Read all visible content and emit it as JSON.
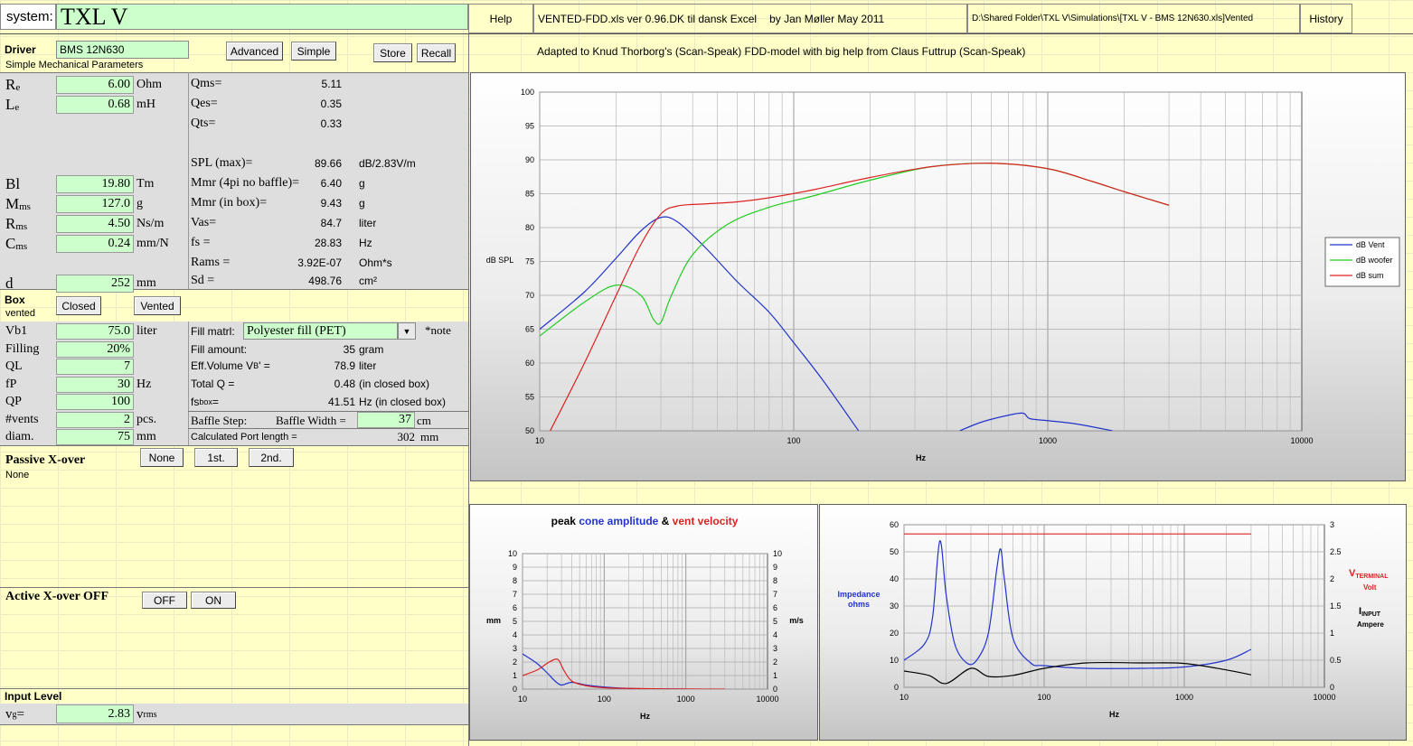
{
  "header": {
    "system_label": "system:",
    "system_name": "TXL V",
    "help": "Help",
    "version": "VENTED-FDD.xls  ver 0.96.DK  til dansk Excel",
    "author": "by  Jan Møller  May 2011",
    "path": "D:\\Shared Folder\\TXL V\\Simulations\\[TXL V - BMS 12N630.xls]Vented",
    "history": "History",
    "adapted": "Adapted to Knud Thorborg's (Scan-Speak)  FDD-model with big help from Claus Futtrup (Scan-Speak)"
  },
  "driver": {
    "label": "Driver",
    "name": "BMS 12N630",
    "sub": "Simple Mechanical Parameters",
    "advanced": "Advanced",
    "simple": "Simple",
    "store": "Store",
    "recall": "Recall"
  },
  "params": [
    {
      "sym": "Re",
      "sub": "e",
      "main": "R",
      "val": "6.00",
      "unit": "Ohm"
    },
    {
      "sym": "Le",
      "sub": "e",
      "main": "L",
      "val": "0.68",
      "unit": "mH"
    },
    {
      "sym": "Bl",
      "main": "Bl",
      "sub": "",
      "val": "19.80",
      "unit": "Tm"
    },
    {
      "sym": "Mms",
      "main": "M",
      "sub": "ms",
      "val": "127.0",
      "unit": "g"
    },
    {
      "sym": "Rms",
      "main": "R",
      "sub": "ms",
      "val": "4.50",
      "unit": "Ns/m"
    },
    {
      "sym": "Cms",
      "main": "C",
      "sub": "ms",
      "val": "0.24",
      "unit": "mm/N"
    },
    {
      "sym": "d",
      "main": "d",
      "sub": "",
      "val": "252",
      "unit": "mm"
    }
  ],
  "derived": [
    {
      "label": "Qms=",
      "val": "5.11",
      "unit": ""
    },
    {
      "label": "Qes=",
      "val": "0.35",
      "unit": ""
    },
    {
      "label": "Qts=",
      "val": "0.33",
      "unit": ""
    },
    {
      "label": "SPL (max)=",
      "val": "89.66",
      "unit": "dB/2.83V/m"
    },
    {
      "label": "Mmr (4pi no baffle)=",
      "val": "6.40",
      "unit": "g"
    },
    {
      "label": "Mmr (in box)=",
      "val": "9.43",
      "unit": "g"
    },
    {
      "label": "Vas=",
      "val": "84.7",
      "unit": "liter"
    },
    {
      "label": "fs =",
      "val": "28.83",
      "unit": "Hz"
    },
    {
      "label": "Rams =",
      "val": "3.92E-07",
      "unit": "Ohm*s"
    },
    {
      "label": "Sd =",
      "val": "498.76",
      "unit": "cm²"
    }
  ],
  "box": {
    "label": "Box",
    "sub": "vented",
    "closed": "Closed",
    "vented": "Vented",
    "rows": [
      {
        "label": "Vb1",
        "val": "75.0",
        "unit": "liter"
      },
      {
        "label": "Filling",
        "val": "20%",
        "unit": ""
      },
      {
        "label": "QL",
        "val": "7",
        "unit": ""
      },
      {
        "label": "fP",
        "val": "30",
        "unit": "Hz"
      },
      {
        "label": "QP",
        "val": "100",
        "unit": ""
      },
      {
        "label": "#vents",
        "val": "2",
        "unit": "pcs."
      },
      {
        "label": "diam.",
        "val": "75",
        "unit": "mm"
      }
    ],
    "fill_label": "Fill matrl:",
    "fill_value": "Polyester fill (PET)",
    "note": "*note",
    "right": [
      {
        "label": "Fill amount:",
        "val": "35",
        "unit": "gram"
      },
      {
        "label": "Eff.Volume V",
        "sub": "B",
        "label2": "' =",
        "val": "78.9",
        "unit": "liter"
      },
      {
        "label": "Total Q =",
        "val": "0.48",
        "unit": "(in closed box)"
      },
      {
        "label": "fs",
        "sub": "box",
        "label2": "=",
        "val": "41.51",
        "unit": "Hz  (in closed box)"
      }
    ],
    "baffle_step": "Baffle Step:",
    "baffle_width": "Baffle Width  =",
    "baffle_val": "37",
    "baffle_unit": "cm",
    "port_label": "Calculated Port length =",
    "port_val": "302",
    "port_unit": "mm"
  },
  "passive": {
    "label": "Passive X-over",
    "state": "None",
    "none": "None",
    "first": "1st.",
    "second": "2nd."
  },
  "active": {
    "label": "Active X-over OFF",
    "off": "OFF",
    "on": "ON"
  },
  "input": {
    "label": "Input Level",
    "sym": "v",
    "sub": "g",
    "eq": " =",
    "val": "2.83",
    "unit": "v",
    "unit_sub": "rms"
  },
  "colors": {
    "vent": "#2233cc",
    "woofer": "#22cc22",
    "sum": "#dd2222"
  },
  "chart_data": [
    {
      "type": "line",
      "title": "",
      "xlabel": "Hz",
      "ylabel": "dB SPL",
      "xscale": "log",
      "xlim": [
        10,
        10000
      ],
      "ylim": [
        50,
        100
      ],
      "xticks": [
        "10",
        "100",
        "1000",
        "10000"
      ],
      "yticks": [
        "50",
        "55",
        "60",
        "65",
        "70",
        "75",
        "80",
        "85",
        "90",
        "95",
        "100"
      ],
      "legend": "right",
      "series": [
        {
          "name": "dB Vent",
          "x": [
            10,
            15,
            20,
            25,
            30,
            35,
            45,
            60,
            80,
            100,
            130,
            180
          ],
          "y": [
            65,
            70.5,
            75.5,
            79.5,
            81.5,
            80.8,
            77,
            72,
            67.5,
            63,
            57.5,
            50
          ]
        },
        {
          "name": "dB Vent",
          "x": [
            450,
            550,
            700,
            800,
            850,
            1000,
            1300,
            1800
          ],
          "y": [
            50,
            51.3,
            52.3,
            52.6,
            51.8,
            51.5,
            51,
            50
          ]
        },
        {
          "name": "dB woofer",
          "x": [
            10,
            15,
            20,
            25,
            28,
            30,
            33,
            40,
            55,
            80,
            120,
            200,
            350,
            600,
            1000,
            1500,
            2000,
            3000
          ],
          "y": [
            64,
            69,
            71.5,
            70,
            66.5,
            66,
            70,
            76,
            80.5,
            83,
            84.7,
            87,
            89,
            89.5,
            88.7,
            86.8,
            85.3,
            83.3
          ]
        },
        {
          "name": "dB sum",
          "x": [
            11,
            15,
            20,
            25,
            30,
            35,
            45,
            60,
            80,
            120,
            200,
            350,
            600,
            1000,
            1500,
            2000,
            3000
          ],
          "y": [
            50,
            60,
            70,
            77.5,
            82,
            83.2,
            83.5,
            83.8,
            84.4,
            85.6,
            87.4,
            89,
            89.5,
            88.7,
            86.8,
            85.3,
            83.3
          ]
        }
      ]
    },
    {
      "type": "line",
      "title": "peak cone amplitude & vent velocity",
      "title_parts": [
        "peak ",
        "cone amplitude",
        " & ",
        "vent velocity"
      ],
      "xlabel": "Hz",
      "ylabel": "mm",
      "ylabel2": "m/s",
      "xscale": "log",
      "xlim": [
        10,
        10000
      ],
      "ylim": [
        0,
        10
      ],
      "ylim2": [
        0,
        10
      ],
      "xticks": [
        "10",
        "100",
        "1000",
        "10000"
      ],
      "yticks": [
        "0",
        "1",
        "2",
        "3",
        "4",
        "5",
        "6",
        "7",
        "8",
        "9",
        "10"
      ],
      "series": [
        {
          "name": "cone amplitude",
          "x": [
            10,
            15,
            20,
            25,
            30,
            40,
            60,
            100,
            200,
            500,
            1000
          ],
          "y": [
            2.6,
            1.9,
            1.2,
            0.6,
            0.3,
            0.5,
            0.3,
            0.15,
            0.05,
            0.01,
            0
          ]
        },
        {
          "name": "vent velocity",
          "x": [
            10,
            15,
            20,
            25,
            28,
            32,
            40,
            60,
            100,
            200,
            500,
            1000,
            3000
          ],
          "y": [
            1.0,
            1.4,
            1.9,
            2.2,
            2.1,
            1.4,
            0.6,
            0.25,
            0.1,
            0.05,
            0.02,
            0.01,
            0
          ]
        }
      ]
    },
    {
      "type": "line",
      "title": "",
      "xlabel": "Hz",
      "ylabel": "Impedance ohms",
      "ylabel2_parts": [
        "V",
        "TERMINAL",
        "Volt",
        "I",
        "INPUT",
        "Ampere"
      ],
      "xscale": "log",
      "xlim": [
        10,
        10000
      ],
      "ylim": [
        0,
        60
      ],
      "ylim2": [
        0,
        3
      ],
      "xticks": [
        "10",
        "100",
        "1000",
        "10000"
      ],
      "yticks": [
        "0",
        "10",
        "20",
        "30",
        "40",
        "50",
        "60"
      ],
      "y2ticks": [
        "0",
        "0.5",
        "1",
        "1.5",
        "2",
        "2.5",
        "3"
      ],
      "series": [
        {
          "name": "Impedance",
          "x": [
            10,
            14,
            16,
            18,
            20,
            23,
            28,
            33,
            40,
            46,
            49,
            52,
            60,
            80,
            100,
            200,
            500,
            1000,
            2000,
            3000
          ],
          "y": [
            10,
            16,
            26,
            54,
            34,
            16,
            9,
            10,
            20,
            44,
            51,
            40,
            18,
            9,
            8,
            7,
            7,
            7.5,
            10,
            14
          ]
        },
        {
          "name": "V terminal",
          "x": [
            10,
            3000
          ],
          "y": [
            2.83,
            2.83
          ]
        },
        {
          "name": "I input",
          "x": [
            10,
            15,
            20,
            30,
            40,
            60,
            100,
            200,
            500,
            1000,
            2000,
            3000
          ],
          "y": [
            0.3,
            0.22,
            0.07,
            0.35,
            0.2,
            0.22,
            0.35,
            0.45,
            0.45,
            0.44,
            0.32,
            0.23
          ]
        }
      ]
    }
  ]
}
